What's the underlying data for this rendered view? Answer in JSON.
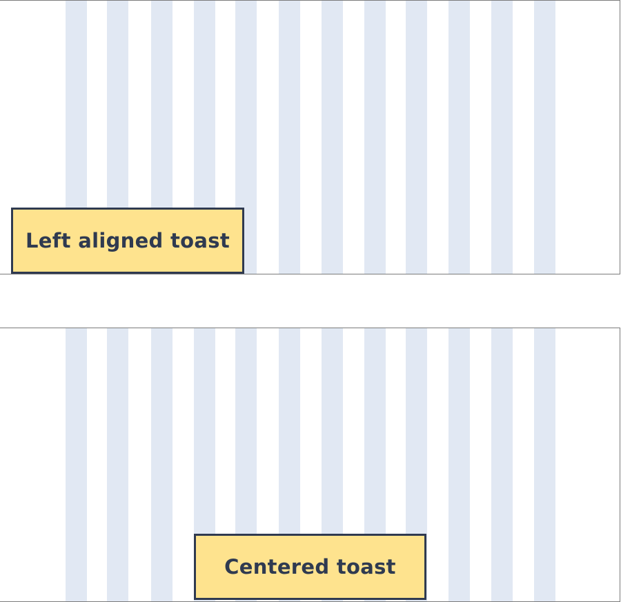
{
  "panels": [
    {
      "toast": {
        "label": "Left aligned toast",
        "alignment": "left"
      }
    },
    {
      "toast": {
        "label": "Centered toast",
        "alignment": "center"
      }
    }
  ],
  "colors": {
    "grid_column": "#e1e8f3",
    "toast_fill": "#fee38e",
    "toast_border": "#2f3a50",
    "panel_border": "#7a7a7a"
  },
  "grid": {
    "column_count": 12
  }
}
